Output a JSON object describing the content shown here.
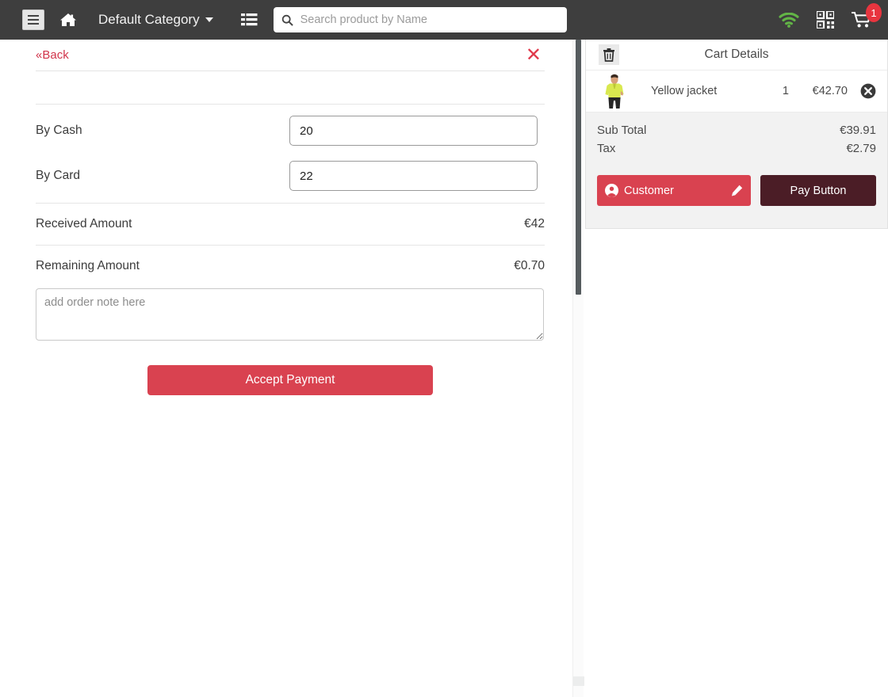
{
  "topbar": {
    "menu_icon": "hamburger-icon",
    "home_icon": "home-icon",
    "category_label": "Default Category",
    "list_icon": "list-icon",
    "search": {
      "icon": "search-icon",
      "placeholder": "Search product by Name",
      "value": ""
    },
    "wifi_icon": "wifi-icon",
    "qr_icon": "qr-code-icon",
    "cart_icon": "shopping-cart-icon",
    "cart_badge": "1"
  },
  "payment_panel": {
    "back_label": "«Back",
    "close_icon": "close-icon",
    "rows": [
      {
        "label": "By Cash",
        "value": "20"
      },
      {
        "label": "By Card",
        "value": "22"
      }
    ],
    "received_label": "Received Amount",
    "received_value": "€42",
    "remaining_label": "Remaining Amount",
    "remaining_value": "€0.70",
    "note_placeholder": "add order note here",
    "note_value": "",
    "accept_label": "Accept Payment"
  },
  "cart": {
    "trash_icon": "trash-icon",
    "title": "Cart Details",
    "items": [
      {
        "thumb": "yellow-jacket-product-image",
        "name": "Yellow jacket",
        "qty": "1",
        "price": "€42.70",
        "remove_icon": "remove-item-icon"
      }
    ],
    "sub_total_label": "Sub Total",
    "sub_total_value": "€39.91",
    "tax_label": "Tax",
    "tax_value": "€2.79",
    "customer_label": "Customer",
    "customer_icon": "user-icon",
    "edit_icon": "pencil-icon",
    "pay_label": "Pay Button"
  },
  "colors": {
    "topbar_bg": "#3e3e3e",
    "accent_red": "#d94250",
    "badge_red": "#e8353f",
    "pay_dark": "#4b1d26",
    "wifi_green": "#62b446",
    "panel_gray": "#f2f2f2"
  }
}
